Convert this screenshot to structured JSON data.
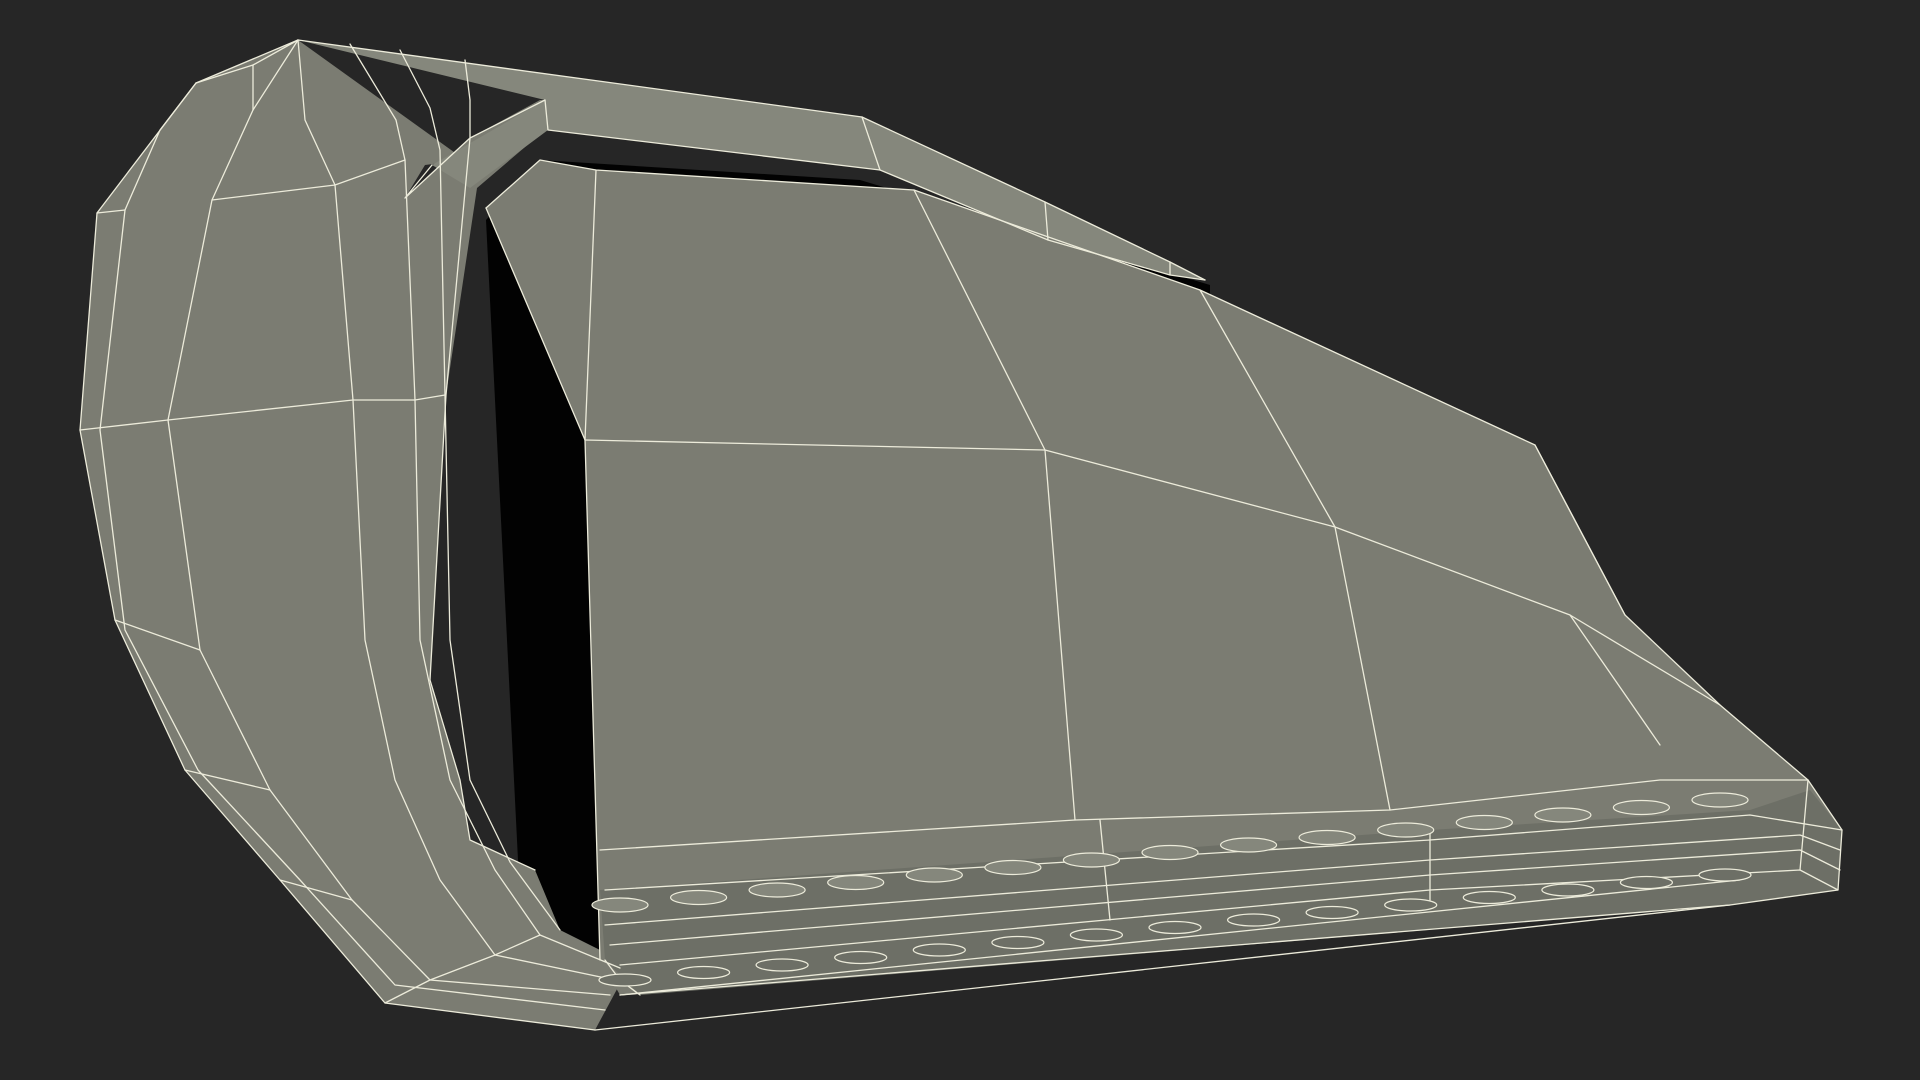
{
  "scene": {
    "subject": "wireframe-render",
    "colors": {
      "background": "#262626",
      "surface": "#7b7c72",
      "surface_light": "#85877c",
      "surface_dark": "#6d6f66",
      "interior": "#020202",
      "wire": "#ecebda"
    },
    "rivet_count": 15
  }
}
